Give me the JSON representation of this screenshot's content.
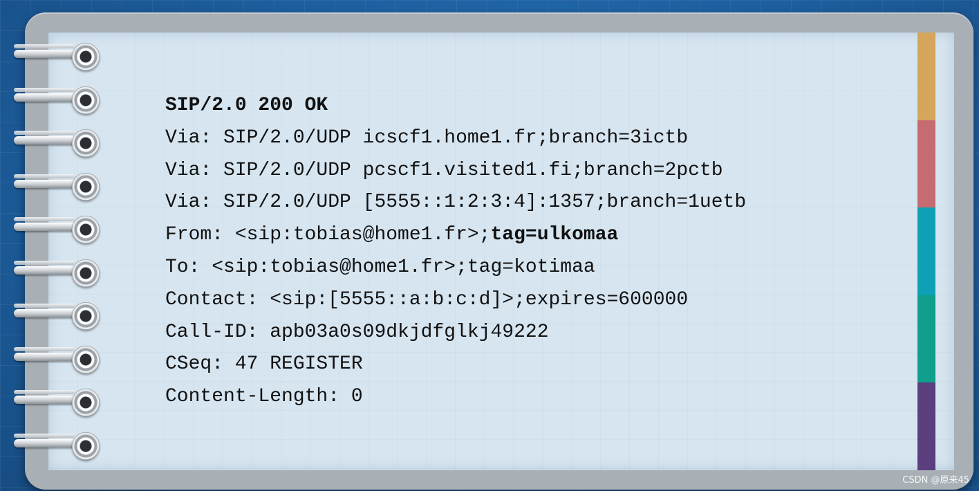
{
  "sip_message": {
    "status_line": "SIP/2.0 200 OK",
    "via_1": "Via: SIP/2.0/UDP icscf1.home1.fr;branch=3ictb",
    "via_2": "Via: SIP/2.0/UDP pcscf1.visited1.fi;branch=2pctb",
    "via_3": "Via: SIP/2.0/UDP [5555::1:2:3:4]:1357;branch=1uetb",
    "from_prefix": "From: <sip:tobias@home1.fr>;",
    "from_tag": "tag=ulkomaa",
    "to": "To: <sip:tobias@home1.fr>;tag=kotimaa",
    "contact": "Contact: <sip:[5555::a:b:c:d]>;expires=600000",
    "call_id": "Call-ID: apb03a0s09dkjdfglkj49222",
    "cseq": "CSeq: 47 REGISTER",
    "content_length": "Content-Length: 0"
  },
  "tabs": [
    "#d4a55a",
    "#c56b71",
    "#0ea0b5",
    "#0f9f8c",
    "#5a3e7e"
  ],
  "watermark": "CSDN @原来45"
}
